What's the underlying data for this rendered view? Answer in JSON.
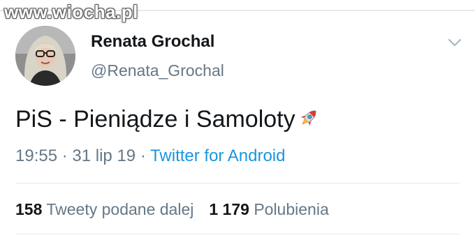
{
  "watermark": "www.wiocha.pl",
  "author": {
    "name": "Renata Grochal",
    "handle": "@Renata_Grochal"
  },
  "tweet": {
    "text": "PiS - Pieniądze i Samoloty",
    "emoji_icon": "rocket-icon",
    "time": "19:55",
    "separator": "·",
    "date": "31 lip 19",
    "source": "Twitter for Android"
  },
  "stats": {
    "retweets_count": "158",
    "retweets_label": "Tweety podane dalej",
    "likes_count": "1 179",
    "likes_label": "Polubienia"
  },
  "colors": {
    "text": "#14171a",
    "secondary": "#657786",
    "link": "#1b95e0",
    "divider": "#e1e8ed"
  }
}
